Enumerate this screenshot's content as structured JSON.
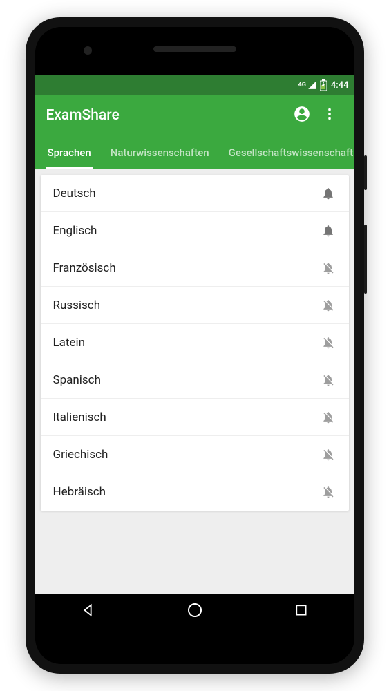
{
  "status_bar": {
    "network": "4G",
    "time": "4:44"
  },
  "app": {
    "title": "ExamShare"
  },
  "tabs": [
    {
      "label": "Sprachen",
      "active": true
    },
    {
      "label": "Naturwissenschaften",
      "active": false
    },
    {
      "label": "Gesellschaftswissenschaft",
      "active": false
    }
  ],
  "list": [
    {
      "label": "Deutsch",
      "bell_on": true
    },
    {
      "label": "Englisch",
      "bell_on": true
    },
    {
      "label": "Französisch",
      "bell_on": false
    },
    {
      "label": "Russisch",
      "bell_on": false
    },
    {
      "label": "Latein",
      "bell_on": false
    },
    {
      "label": "Spanisch",
      "bell_on": false
    },
    {
      "label": "Italienisch",
      "bell_on": false
    },
    {
      "label": "Griechisch",
      "bell_on": false
    },
    {
      "label": "Hebräisch",
      "bell_on": false
    }
  ]
}
